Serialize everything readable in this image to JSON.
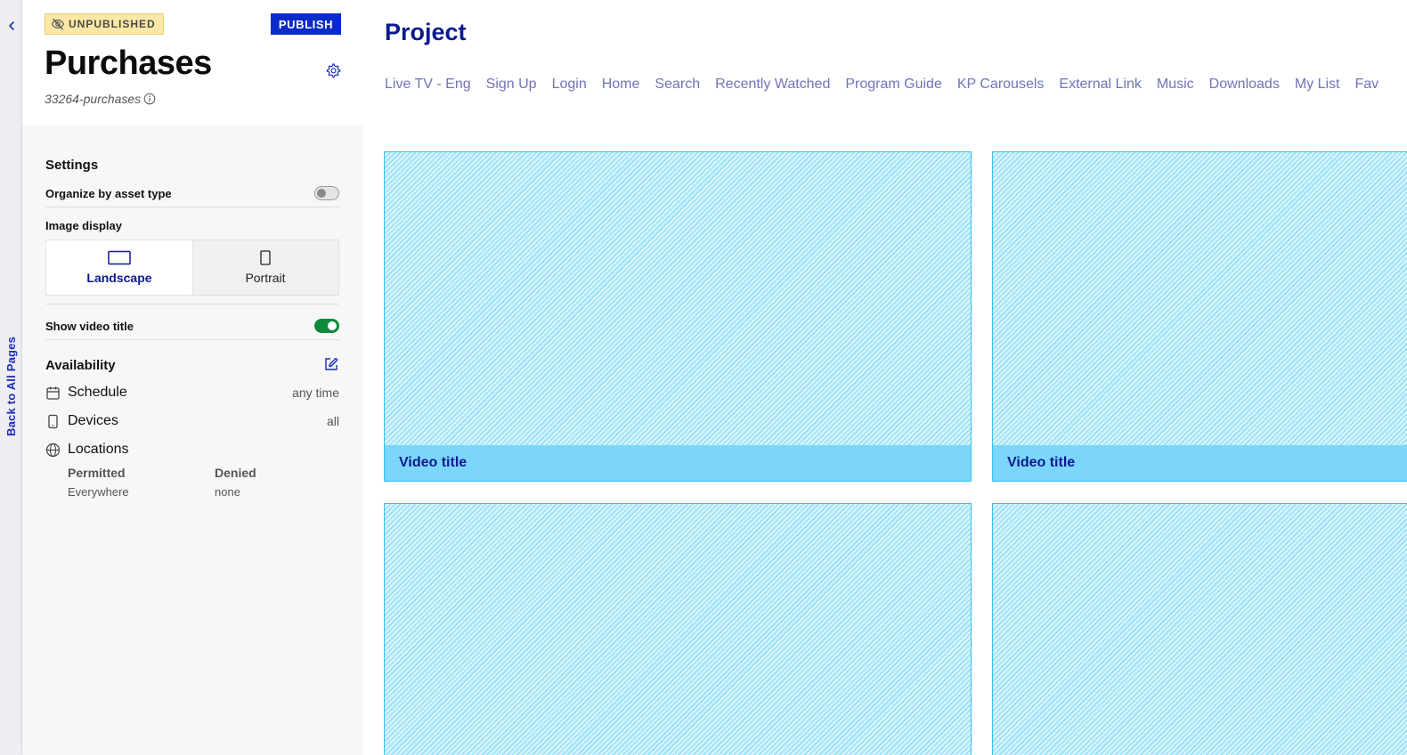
{
  "rail": {
    "back_label": "Back to All Pages"
  },
  "panel": {
    "status_badge": "UNPUBLISHED",
    "publish_label": "PUBLISH",
    "page_title": "Purchases",
    "page_slug": "33264-purchases",
    "settings": {
      "heading": "Settings",
      "organize_label": "Organize by asset type",
      "organize_on": false,
      "image_display_label": "Image display",
      "image_options": [
        "Landscape",
        "Portrait"
      ],
      "image_selected": "Landscape",
      "show_title_label": "Show video title",
      "show_title_on": true
    },
    "availability": {
      "heading": "Availability",
      "schedule_label": "Schedule",
      "schedule_value": "any time",
      "devices_label": "Devices",
      "devices_value": "all",
      "locations_label": "Locations",
      "permitted_header": "Permitted",
      "permitted_value": "Everywhere",
      "denied_header": "Denied",
      "denied_value": "none"
    }
  },
  "main": {
    "project_title": "Project",
    "nav": [
      "Live TV - Eng",
      "Sign Up",
      "Login",
      "Home",
      "Search",
      "Recently Watched",
      "Program Guide",
      "KP Carousels",
      "External Link",
      "Music",
      "Downloads",
      "My List",
      "Fav"
    ],
    "tiles": [
      {
        "caption": "Video title"
      },
      {
        "caption": "Video title"
      },
      {
        "caption": ""
      },
      {
        "caption": ""
      }
    ]
  },
  "colors": {
    "accent": "#0a2bc9",
    "nav_link": "#6f74b8",
    "toggle_on": "#108a3a",
    "tile_border": "#32c2ee",
    "tile_caption_bg": "#7cd6fb",
    "unpublished_bg": "#fbe8a6"
  },
  "icons": {
    "rail": "chevron-left-icon",
    "status": "eye-off-icon",
    "settings": "gear-icon",
    "slug_info": "info-icon",
    "landscape": "landscape-rect-icon",
    "portrait": "portrait-rect-icon",
    "edit": "edit-icon",
    "schedule": "calendar-icon",
    "devices": "phone-icon",
    "locations": "globe-icon"
  }
}
